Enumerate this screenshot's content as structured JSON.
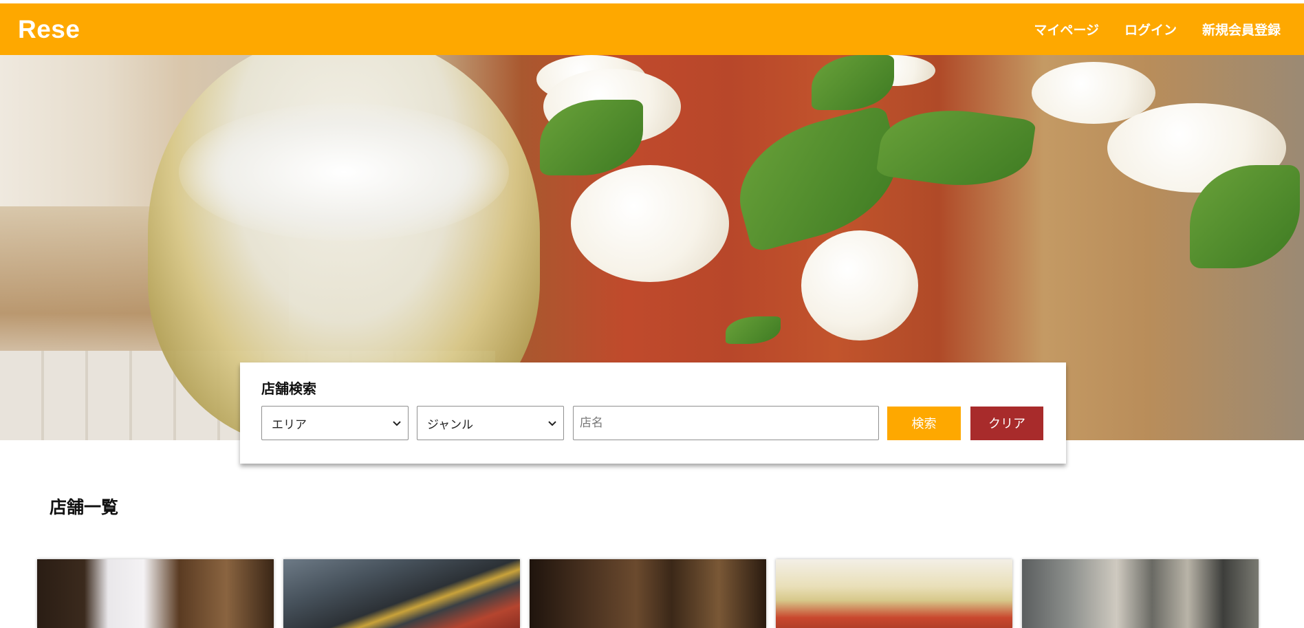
{
  "header": {
    "logo": "Rese",
    "nav": [
      {
        "label": "マイページ"
      },
      {
        "label": "ログイン"
      },
      {
        "label": "新規会員登録"
      }
    ]
  },
  "hero": {
    "image": "pizza-and-wine-photo"
  },
  "search": {
    "title": "店舗検索",
    "area_select": {
      "selected": "エリア"
    },
    "genre_select": {
      "selected": "ジャンル"
    },
    "name_input": {
      "placeholder": "店名",
      "value": ""
    },
    "search_button": "検索",
    "clear_button": "クリア"
  },
  "shop_list": {
    "title": "店舗一覧",
    "cards": [
      {
        "image": "sushi-chef-photo"
      },
      {
        "image": "yakiniku-grill-photo"
      },
      {
        "image": "izakaya-interior-photo"
      },
      {
        "image": "pizza-and-wine-photo"
      },
      {
        "image": "kitchen-chef-photo"
      }
    ]
  },
  "colors": {
    "accent": "#fea800",
    "clear_button": "#a82b2b",
    "header_text": "#ffffff"
  }
}
